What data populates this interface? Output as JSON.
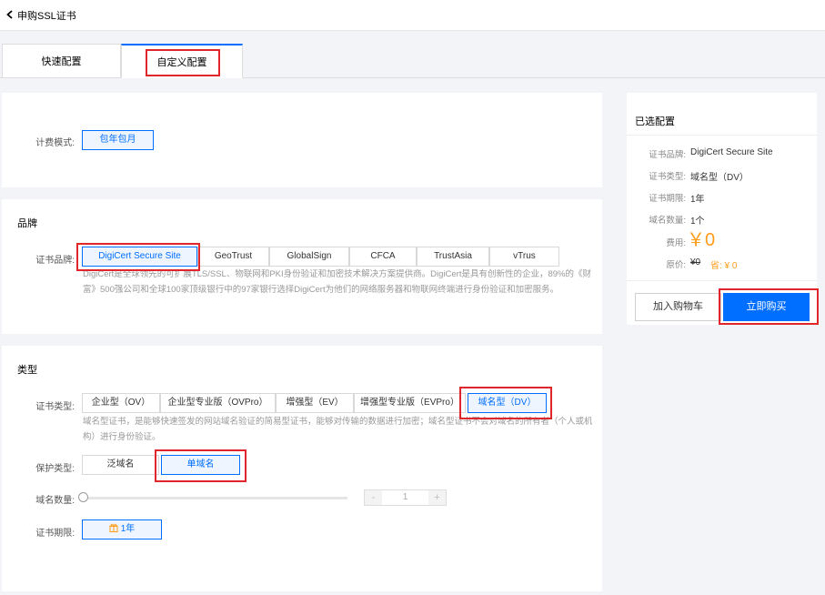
{
  "header": {
    "title": "申购SSL证书"
  },
  "tabs": [
    {
      "label": "快速配置"
    },
    {
      "label": "自定义配置"
    }
  ],
  "billing": {
    "label": "计费模式:",
    "option": "包年包月"
  },
  "brand": {
    "section_title": "品牌",
    "label": "证书品牌:",
    "options": [
      "DigiCert Secure Site",
      "GeoTrust",
      "GlobalSign",
      "CFCA",
      "TrustAsia",
      "vTrus"
    ],
    "description_line1": "DigiCert是全球领先的可扩展TLS/SSL、物联网和PKI身份验证和加密技术解决方案提供商。DigiCert是具有创新性的企业，89%的《财",
    "description_line2": "富》500强公司和全球100家顶级银行中的97家银行选择DigiCert为他们的网络服务器和物联网终端进行身份验证和加密服务。"
  },
  "type": {
    "section_title": "类型",
    "label": "证书类型:",
    "options": [
      "企业型（OV）",
      "企业型专业版（OVPro）",
      "增强型（EV）",
      "增强型专业版（EVPro）",
      "域名型（DV）"
    ],
    "description_line1": "域名型证书，是能够快速签发的网站域名验证的简易型证书，能够对传输的数据进行加密；域名型证书不会对域名的所有者（个人或机",
    "description_line2": "构）进行身份验证。",
    "protect_label": "保护类型:",
    "protect_options": [
      "泛域名",
      "单域名"
    ],
    "domain_count_label": "域名数量:",
    "stepper_minus": "-",
    "stepper_value": "1",
    "stepper_plus": "+",
    "period_label": "证书期限:",
    "period_option": "1年"
  },
  "summary": {
    "title": "已选配置",
    "brand_label": "证书品牌:",
    "brand_value": "DigiCert Secure Site",
    "type_label": "证书类型:",
    "type_value": "域名型（DV）",
    "period_label": "证书期限:",
    "period_value": "1年",
    "count_label": "域名数量:",
    "count_value": "1个",
    "fee_label": "费用:",
    "fee_value": "￥0",
    "original_label": "原价:",
    "original_value": "¥0",
    "saving_value": "省: ¥ 0",
    "add_cart_label": "加入购物车",
    "buy_label": "立即购买"
  },
  "colors": {
    "accent": "#006eff",
    "price": "#ff9c19",
    "highlight_box": "#e0252b"
  }
}
